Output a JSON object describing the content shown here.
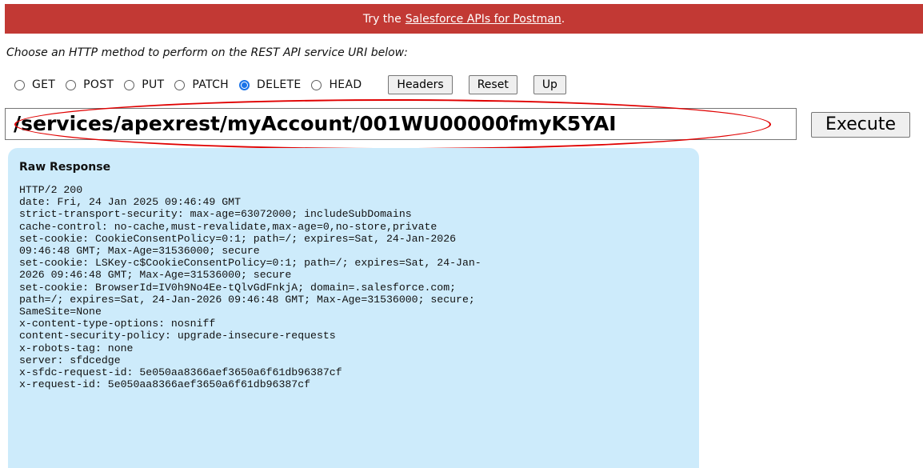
{
  "banner": {
    "prefix": "Try the",
    "link": "Salesforce APIs for Postman",
    "suffix": "."
  },
  "instruction": "Choose an HTTP method to perform on the REST API service URI below:",
  "methods": [
    {
      "label": "GET",
      "checked": false
    },
    {
      "label": "POST",
      "checked": false
    },
    {
      "label": "PUT",
      "checked": false
    },
    {
      "label": "PATCH",
      "checked": false
    },
    {
      "label": "DELETE",
      "checked": true
    },
    {
      "label": "HEAD",
      "checked": false
    }
  ],
  "buttons": {
    "headers": "Headers",
    "reset": "Reset",
    "up": "Up",
    "execute": "Execute"
  },
  "uri": {
    "value": "/services/apexrest/myAccount/001WU00000fmyK5YAI"
  },
  "colors": {
    "banner": "#c23934",
    "highlight": "#e00000",
    "response_bg": "#cdebfb",
    "radio_checked": "#1a73e8"
  },
  "response": {
    "title": "Raw Response",
    "lines": [
      "HTTP/2 200",
      "date: Fri, 24 Jan 2025 09:46:49 GMT",
      "strict-transport-security: max-age=63072000; includeSubDomains",
      "cache-control: no-cache,must-revalidate,max-age=0,no-store,private",
      "set-cookie: CookieConsentPolicy=0:1; path=/; expires=Sat, 24-Jan-2026",
      "09:46:48 GMT; Max-Age=31536000; secure",
      "set-cookie: LSKey-c$CookieConsentPolicy=0:1; path=/; expires=Sat, 24-Jan-",
      "2026 09:46:48 GMT; Max-Age=31536000; secure",
      "set-cookie: BrowserId=IV0h9No4Ee-tQlvGdFnkjA; domain=.salesforce.com;",
      "path=/; expires=Sat, 24-Jan-2026 09:46:48 GMT; Max-Age=31536000; secure;",
      "SameSite=None",
      "x-content-type-options: nosniff",
      "content-security-policy: upgrade-insecure-requests",
      "x-robots-tag: none",
      "server: sfdcedge",
      "x-sfdc-request-id: 5e050aa8366aef3650a6f61db96387cf",
      "x-request-id: 5e050aa8366aef3650a6f61db96387cf"
    ]
  }
}
